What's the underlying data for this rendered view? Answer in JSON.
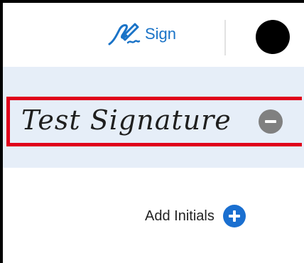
{
  "toolbar": {
    "sign_label": "Sign",
    "sign_icon": "pen-signature-icon",
    "ink_color": "#000000",
    "accent_color": "#1a73c7"
  },
  "signatures": {
    "items": [
      {
        "text": "Test Signature",
        "remove_icon": "minus-circle-icon",
        "selected": true
      }
    ],
    "highlight_color": "#e0001b",
    "panel_color": "#e6eef8"
  },
  "initials": {
    "add_label": "Add Initials",
    "add_icon": "plus-circle-icon"
  }
}
